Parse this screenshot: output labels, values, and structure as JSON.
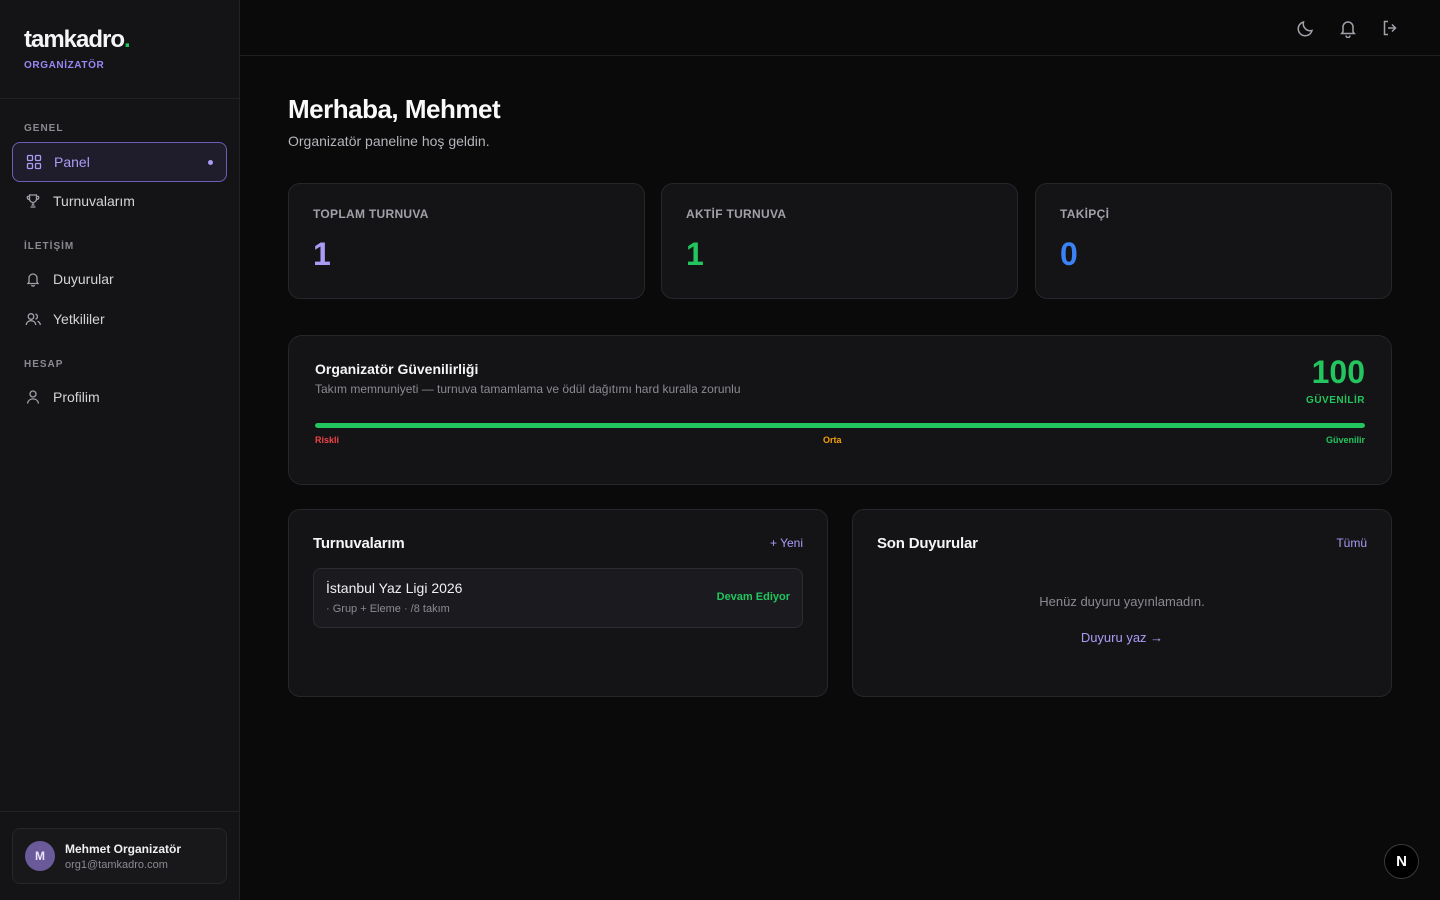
{
  "brand": {
    "name": "tamkadro",
    "dot": ".",
    "role": "ORGANİZATÖR"
  },
  "sidebar": {
    "sections": [
      {
        "label": "GENEL"
      },
      {
        "label": "İLETİŞİM"
      },
      {
        "label": "HESAP"
      }
    ],
    "items": [
      {
        "label": "Panel",
        "icon": "grid-icon",
        "active": true
      },
      {
        "label": "Turnuvalarım",
        "icon": "trophy-icon"
      },
      {
        "label": "Duyurular",
        "icon": "bell-icon"
      },
      {
        "label": "Yetkililer",
        "icon": "users-icon"
      },
      {
        "label": "Profilim",
        "icon": "user-icon"
      }
    ],
    "user": {
      "initial": "M",
      "name": "Mehmet Organizatör",
      "email": "org1@tamkadro.com"
    }
  },
  "topbar": {
    "icons": [
      "moon-icon",
      "bell-icon",
      "logout-icon"
    ]
  },
  "main": {
    "greeting": "Merhaba, Mehmet",
    "subtitle": "Organizatör paneline hoş geldin.",
    "stats": [
      {
        "label": "TOPLAM TURNUVA",
        "value": "1",
        "color": "#a99cf5"
      },
      {
        "label": "AKTİF TURNUVA",
        "value": "1",
        "color": "#22c55e"
      },
      {
        "label": "TAKİPÇİ",
        "value": "0",
        "color": "#3b82f6"
      }
    ],
    "trust": {
      "title": "Organizatör Güvenilirliği",
      "description": "Takım memnuniyeti — turnuva tamamlama ve ödül dağıtımı hard kuralla zorunlu",
      "score": "100",
      "score_label": "GÜVENİLİR",
      "level_percent": 100,
      "scale": {
        "low": "Riskli",
        "mid": "Orta",
        "high": "Güvenilir"
      },
      "colors": {
        "low": "#ef4444",
        "mid": "#f59e0b",
        "high": "#22c55e"
      }
    },
    "tournaments": {
      "title": "Turnuvalarım",
      "new_label": "+ Yeni",
      "items": [
        {
          "name": "İstanbul Yaz Ligi 2026",
          "meta": "· Grup + Eleme · /8 takım",
          "status": "Devam Ediyor"
        }
      ]
    },
    "announcements": {
      "title": "Son Duyurular",
      "all_label": "Tümü",
      "empty_text": "Henüz duyuru yayınlamadın.",
      "write_label": "Duyuru yaz →"
    }
  },
  "dev_badge": "N"
}
